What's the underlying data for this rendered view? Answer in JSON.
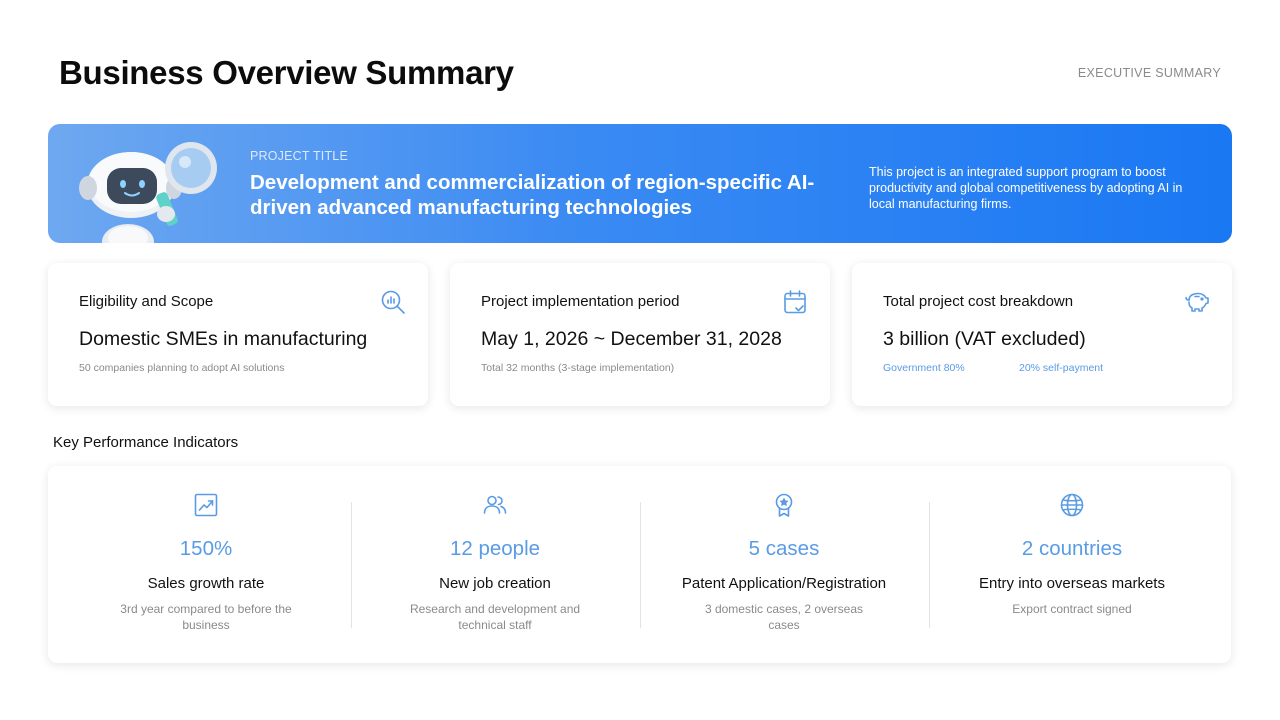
{
  "header": {
    "title": "Business Overview Summary",
    "tag": "EXECUTIVE SUMMARY"
  },
  "banner": {
    "label": "PROJECT TITLE",
    "project_name": "Development and commercialization of region-specific AI-driven advanced manufacturing technologies",
    "description": "This project is an integrated support program to boost productivity and global competitiveness by adopting AI in local manufacturing firms.",
    "gradient": [
      "#6ea8f0",
      "#1a78f3"
    ]
  },
  "cards": [
    {
      "title": "Eligibility and Scope",
      "value": "Domestic SMEs in manufacturing",
      "sub": "50 companies planning to adopt AI solutions",
      "icon": "magnifier-chart-icon"
    },
    {
      "title": "Project implementation period",
      "value": "May 1, 2026 ~ December 31, 2028",
      "sub": "Total 32 months (3-stage implementation)",
      "icon": "calendar-check-icon"
    },
    {
      "title": "Total project cost breakdown",
      "value": "3 billion (VAT excluded)",
      "sub": "Government 80%",
      "sub2": "20% self-payment",
      "icon": "piggy-bank-icon"
    }
  ],
  "kpi_section": {
    "title": "Key Performance Indicators"
  },
  "kpis": [
    {
      "value": "150%",
      "label": "Sales growth rate",
      "desc": "3rd year compared to before the business",
      "icon": "trend-chart-icon"
    },
    {
      "value": "12 people",
      "label": "New job creation",
      "desc": "Research and development and technical staff",
      "icon": "users-icon"
    },
    {
      "value": "5 cases",
      "label": "Patent Application/Registration",
      "desc": "3 domestic cases, 2 overseas cases",
      "icon": "award-badge-icon"
    },
    {
      "value": "2 countries",
      "label": "Entry into overseas markets",
      "desc": "Export contract signed",
      "icon": "globe-icon"
    }
  ],
  "colors": {
    "accent": "#5a9be6",
    "banner_blue": "#1a78f3",
    "text": "#111111",
    "muted": "#8a8a8a"
  }
}
